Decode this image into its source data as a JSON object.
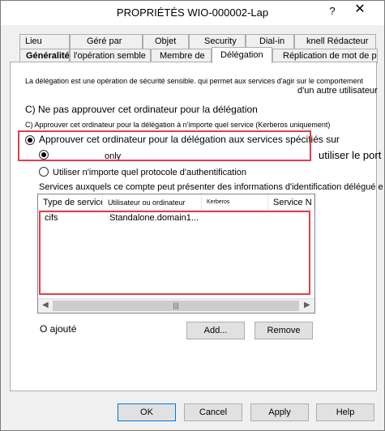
{
  "window": {
    "title": "PROPRIÉTÉS WIO-000002-Lap",
    "help_label": "?",
    "close_label": "✕"
  },
  "tabs_row1": [
    {
      "label": "Lieu"
    },
    {
      "label": "Géré par"
    },
    {
      "label": "Objet"
    },
    {
      "label": "Security"
    },
    {
      "label": "Dial-in"
    },
    {
      "label": "knell Rédacteur"
    }
  ],
  "tabs_row2": [
    {
      "label": "Généralités"
    },
    {
      "label": "l'opération semble"
    },
    {
      "label": "Membre de"
    },
    {
      "label": "Délégation"
    },
    {
      "label": "Réplication de mot de passe"
    }
  ],
  "delegation": {
    "intro_line1": "La délégation est une opération de sécurité sensible. qui permet aux services d'agir sur le comportement",
    "intro_line2": "d'un autre utilisateur",
    "option_no_trust": "C) Ne pas approuver cet ordinateur pour la délégation",
    "option_any_service": "C) Approuver cet ordinateur pour la délégation à n'importe quel service (Kerberos uniquement)",
    "option_specified": "Approuver cet ordinateur pour la délégation aux services spécifiés sur",
    "option_kerberos_only": "only",
    "overflow_text": "utiliser le port",
    "option_any_protocol": "Utiliser n'importe quel protocole d'authentification",
    "services_label": "Services auxquels ce compte peut présenter des informations d'identification délégué e s :",
    "columns": [
      "Type de service",
      "Utilisateur ou ordinateur",
      "Kerberos",
      "Service N"
    ],
    "rows": [
      {
        "type": "cifs",
        "host": "Standalone.domain1..."
      }
    ],
    "expanded_label": "O ajouté",
    "add_label": "Add...",
    "remove_label": "Remove"
  },
  "footer": {
    "ok": "OK",
    "cancel": "Cancel",
    "apply": "Apply",
    "help": "Help"
  }
}
